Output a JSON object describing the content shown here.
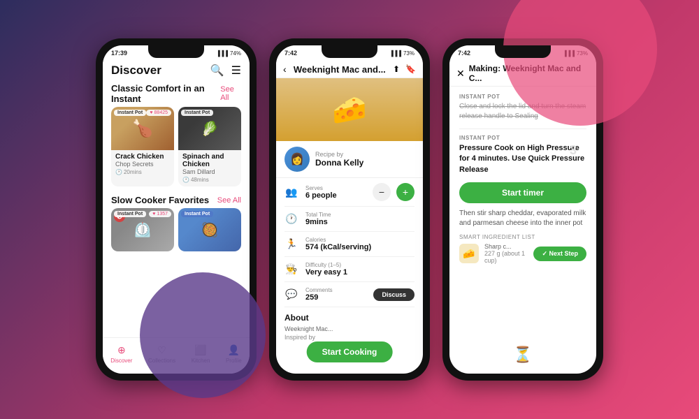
{
  "background": {
    "color1": "#2d2d5e",
    "color2": "#c0386a"
  },
  "phone1": {
    "status_time": "17:39",
    "status_battery": "74%",
    "header_title": "Discover",
    "section1_title": "Classic Comfort in an Instant",
    "see_all_1": "See All",
    "recipe1_tag": "Instant Pot",
    "recipe1_likes": "88425",
    "recipe1_name": "Crack Chicken",
    "recipe1_author": "Chop Secrets",
    "recipe1_time": "20mins",
    "recipe2_tag": "Instant Pot",
    "recipe2_name": "Spinach and Chicken",
    "recipe2_author": "Sam Dillard",
    "recipe2_time": "48mins",
    "section2_title": "Slow Cooker Favorites",
    "see_all_2": "See All",
    "recipe3_tag": "Instant Pot",
    "recipe3_likes": "1357",
    "nav_discover": "Discover",
    "nav_collections": "Collections",
    "nav_kitchen": "Kitchen",
    "nav_profile": "Profile"
  },
  "phone2": {
    "status_time": "7:42",
    "status_battery": "73%",
    "header_title": "Weeknight Mac and...",
    "recipe_by_label": "Recipe by",
    "author_name": "Donna Kelly",
    "serves_label": "Serves",
    "serves_value": "6 people",
    "time_label": "Total Time",
    "time_value": "9mins",
    "calories_label": "Calories",
    "calories_value": "574 (kCal/serving)",
    "difficulty_label": "Difficulty (1–5)",
    "difficulty_value": "Very easy 1",
    "comments_label": "Comments",
    "comments_value": "259",
    "discuss_label": "Discuss",
    "about_label": "About",
    "about_text": "Weeknight Mac...",
    "inspired_label": "Inspired by",
    "start_cooking_label": "Start Cooking"
  },
  "phone3": {
    "status_time": "7:42",
    "status_battery": "73%",
    "header_title": "Making: Weeknight Mac and C...",
    "step1_tag": "INSTANT POT",
    "step1_text": "Close and lock the lid and turn the steam release handle to Sealing",
    "step2_tag": "INSTANT POT",
    "step2_number": "3",
    "step2_text": "Pressure Cook on High Pressure for 4 minutes. Use Quick Pressure Release",
    "start_timer_label": "Start timer",
    "step3_text": "Then stir sharp cheddar, evaporated milk and parmesan cheese into the inner pot",
    "smart_list_label": "SMART INGREDIENT LIST",
    "ingredient_name": "Sharp c...",
    "ingredient_amount": "227 g (about 1 cup)",
    "next_step_label": "✓ Next Step"
  }
}
